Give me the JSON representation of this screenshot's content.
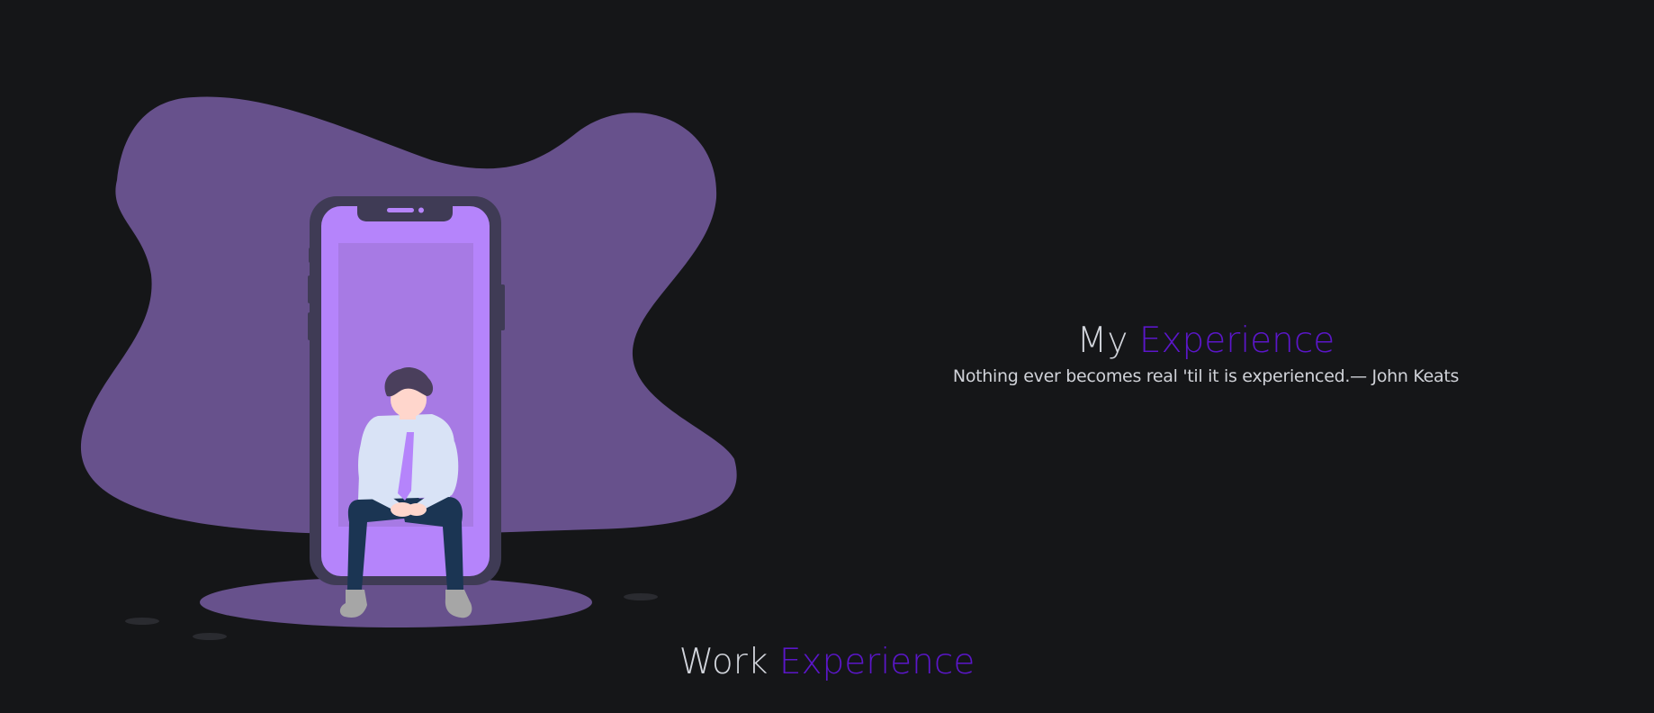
{
  "hero": {
    "title_plain": "My",
    "title_accent": "Experience",
    "quote": "Nothing ever becomes real 'til it is experienced.— John Keats"
  },
  "section": {
    "title_plain": "Work",
    "title_accent": "Experience"
  },
  "colors": {
    "background": "#151618",
    "blob": "#67518c",
    "phone_frame": "#3f3b55",
    "phone_screen": "#b584fb",
    "accent_text": "#5b16c9",
    "light_text": "#d2d5dc"
  },
  "icons": {
    "illustration": "person-sitting-on-phone-illustration"
  }
}
